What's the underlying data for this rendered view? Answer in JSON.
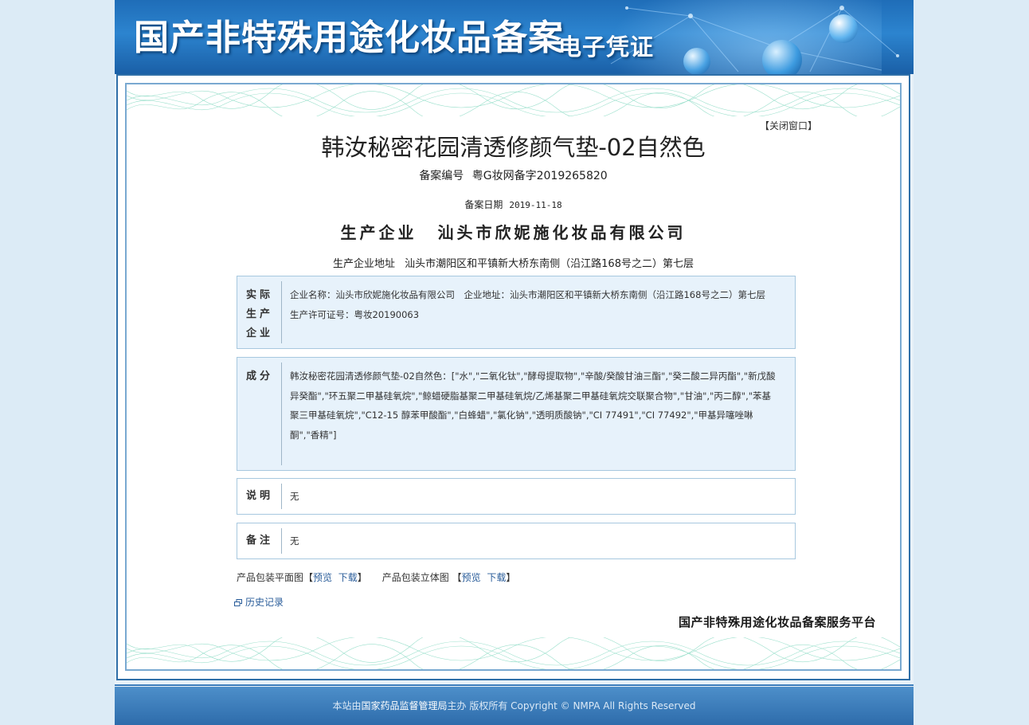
{
  "header": {
    "title": "国产非特殊用途化妆品备案",
    "subtitle": "电子凭证"
  },
  "certificate": {
    "close_label": "【关闭窗口】",
    "product_name": "韩汝秘密花园清透修颜气垫-02自然色",
    "reg_label": "备案编号",
    "reg_value": "粤G妆网备字2019265820",
    "date_label": "备案日期",
    "date_value": "2019-11-18",
    "company_label": "生产企业",
    "company_value": "汕头市欣妮施化妆品有限公司",
    "address_label": "生产企业地址",
    "address_value": "汕头市潮阳区和平镇新大桥东南侧（沿江路168号之二）第七层",
    "actual_producer": {
      "label": "实际生产企业",
      "content": "企业名称：汕头市欣妮施化妆品有限公司　企业地址：汕头市潮阳区和平镇新大桥东南侧（沿江路168号之二）第七层　生产许可证号：粤妆20190063"
    },
    "ingredients": {
      "label": "成分",
      "content": "韩汝秘密花园清透修颜气垫-02自然色：[\"水\",\"二氧化钛\",\"酵母提取物\",\"辛酸/癸酸甘油三酯\",\"癸二酸二异丙酯\",\"新戊酸异癸酯\",\"环五聚二甲基硅氧烷\",\"鲸蜡硬脂基聚二甲基硅氧烷/乙烯基聚二甲基硅氧烷交联聚合物\",\"甘油\",\"丙二醇\",\"苯基聚三甲基硅氧烷\",\"C12-15 醇苯甲酸酯\",\"白蜂蜡\",\"氯化钠\",\"透明质酸钠\",\"CI 77491\",\"CI 77492\",\"甲基异噻唑啉酮\",\"香精\"]"
    },
    "note": {
      "label": "说明",
      "content": "无"
    },
    "remark": {
      "label": "备注",
      "content": "无"
    },
    "packaging": {
      "flat_label": "产品包装平面图",
      "solid_label": "产品包装立体图",
      "preview": "预览",
      "download": "下载",
      "bracket_open": "【",
      "bracket_close": "】"
    },
    "history_label": "历史记录",
    "platform_name": "国产非特殊用途化妆品备案服务平台"
  },
  "footer": {
    "prefix": "本站由",
    "org": "国家药品监督管理局",
    "suffix": "主办 版权所有 Copyright © NMPA All Rights Reserved"
  },
  "colors": {
    "banner": "#2c84cf",
    "frame": "#2f6fa8",
    "info_box_bg": "#e7f2fb",
    "link": "#2a5d9a",
    "guilloche": "#6fcfb8"
  }
}
